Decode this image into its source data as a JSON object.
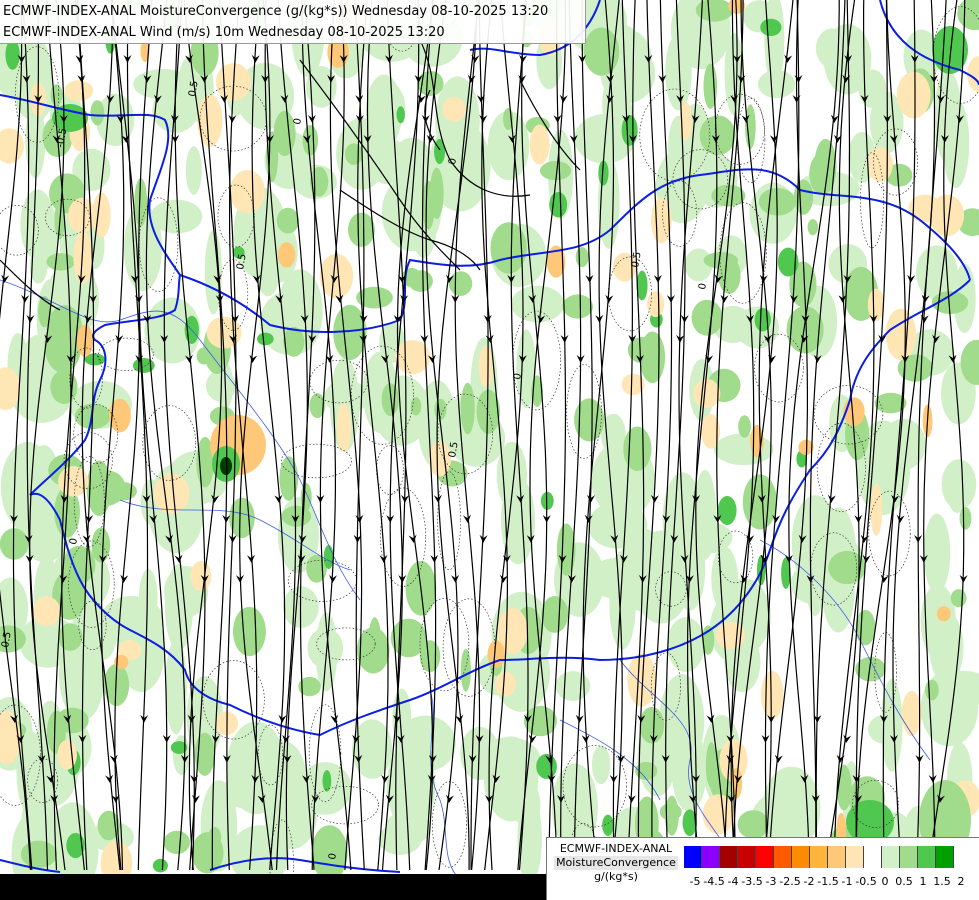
{
  "header": {
    "line1": "ECMWF-INDEX-ANAL MoistureConvergence (g/(kg*s)) Wednesday 08-10-2025 13:20",
    "line2": "ECMWF-INDEX-ANAL Wind (m/s) 10m Wednesday 08-10-2025 13:20"
  },
  "legend": {
    "line1": "ECMWF-INDEX-ANAL",
    "line2": "MoistureConvergence",
    "line3": "g/(kg*s)",
    "bins": [
      {
        "label": "-5",
        "color": "#0000ff"
      },
      {
        "label": "-4.5",
        "color": "#8c00ff"
      },
      {
        "label": "-4",
        "color": "#a50000"
      },
      {
        "label": "-3.5",
        "color": "#c80000"
      },
      {
        "label": "-3",
        "color": "#ff0000"
      },
      {
        "label": "-2.5",
        "color": "#ff5a00"
      },
      {
        "label": "-2",
        "color": "#ff8c00"
      },
      {
        "label": "-1.5",
        "color": "#ffb43c"
      },
      {
        "label": "-1",
        "color": "#ffc878"
      },
      {
        "label": "-0.5",
        "color": "#ffe6b4"
      },
      {
        "label": "0",
        "color": "#ffffff"
      },
      {
        "label": "0.5",
        "color": "#d2f0c8"
      },
      {
        "label": "1",
        "color": "#a0dc8c"
      },
      {
        "label": "1.5",
        "color": "#50c850"
      },
      {
        "label": "2",
        "color": "#00a000"
      }
    ]
  },
  "map": {
    "fill_colors": {
      "neg_light": "#ffe6b4",
      "neg_mid": "#ffc878",
      "pos_light": "#d2f0c8",
      "pos_mid": "#a0dc8c",
      "pos_strong": "#50c850",
      "pos_max": "#008000",
      "border": "#0a1ee6",
      "river": "#3c5ae6",
      "streamline": "#000000"
    },
    "contour_labels": [
      "0",
      "0.5",
      "-0.5",
      "0",
      "0.5",
      "0",
      "0.5",
      "0",
      "0.5",
      "0",
      "0.5",
      "0"
    ]
  }
}
